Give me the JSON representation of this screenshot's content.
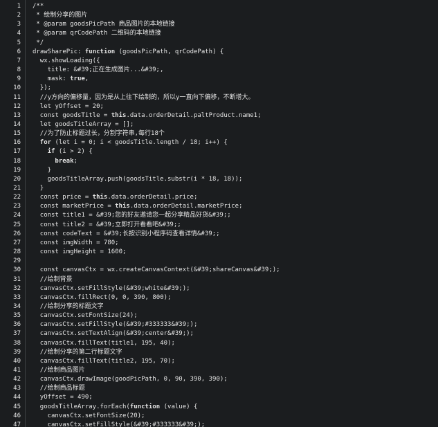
{
  "editor": {
    "lines": [
      {
        "n": "1",
        "indent": 0,
        "tokens": [
          {
            "t": "/**",
            "c": "cm"
          }
        ]
      },
      {
        "n": "2",
        "indent": 1,
        "tokens": [
          {
            "t": "* 绘制分享的图片",
            "c": "cm"
          }
        ]
      },
      {
        "n": "3",
        "indent": 1,
        "tokens": [
          {
            "t": "* @param goodsPicPath 商品图片的本地链接",
            "c": "cm"
          }
        ]
      },
      {
        "n": "4",
        "indent": 1,
        "tokens": [
          {
            "t": "* @param qrCodePath 二维码的本地链接",
            "c": "cm"
          }
        ]
      },
      {
        "n": "5",
        "indent": 1,
        "tokens": [
          {
            "t": "*/",
            "c": "cm"
          }
        ]
      },
      {
        "n": "6",
        "indent": 0,
        "tokens": [
          {
            "t": "drawSharePic: ",
            "c": ""
          },
          {
            "t": "function",
            "c": "kw"
          },
          {
            "t": " (goodsPicPath, qrCodePath) {",
            "c": ""
          }
        ]
      },
      {
        "n": "7",
        "indent": 2,
        "tokens": [
          {
            "t": "wx.showLoading({",
            "c": ""
          }
        ]
      },
      {
        "n": "8",
        "indent": 4,
        "tokens": [
          {
            "t": "title: ",
            "c": ""
          },
          {
            "t": "&#39;正在生成图片...&#39;,",
            "c": "str"
          }
        ]
      },
      {
        "n": "9",
        "indent": 4,
        "tokens": [
          {
            "t": "mask: ",
            "c": ""
          },
          {
            "t": "true",
            "c": "kw"
          },
          {
            "t": ",",
            "c": ""
          }
        ]
      },
      {
        "n": "10",
        "indent": 2,
        "tokens": [
          {
            "t": "});",
            "c": ""
          }
        ]
      },
      {
        "n": "11",
        "indent": 2,
        "tokens": [
          {
            "t": "//y方向的偏移量，因为是从上往下绘制的，所以y一直向下偏移，不断增大。",
            "c": "cm"
          }
        ]
      },
      {
        "n": "12",
        "indent": 2,
        "tokens": [
          {
            "t": "let yOffset = 20;",
            "c": ""
          }
        ]
      },
      {
        "n": "13",
        "indent": 2,
        "tokens": [
          {
            "t": "const goodsTitle = ",
            "c": ""
          },
          {
            "t": "this",
            "c": "kw"
          },
          {
            "t": ".data.orderDetail.paltProduct.name1;",
            "c": ""
          }
        ]
      },
      {
        "n": "14",
        "indent": 2,
        "tokens": [
          {
            "t": "let goodsTitleArray = [];",
            "c": ""
          }
        ]
      },
      {
        "n": "15",
        "indent": 2,
        "tokens": [
          {
            "t": "//为了防止标题过长，分割字符串,每行18个",
            "c": "cm"
          }
        ]
      },
      {
        "n": "16",
        "indent": 2,
        "tokens": [
          {
            "t": "for",
            "c": "kw"
          },
          {
            "t": " (let i = 0; i < goodsTitle.length / 18; i++) {",
            "c": ""
          }
        ]
      },
      {
        "n": "17",
        "indent": 4,
        "tokens": [
          {
            "t": "if",
            "c": "kw"
          },
          {
            "t": " (i > 2) {",
            "c": ""
          }
        ]
      },
      {
        "n": "18",
        "indent": 6,
        "tokens": [
          {
            "t": "break",
            "c": "kw"
          },
          {
            "t": ";",
            "c": ""
          }
        ]
      },
      {
        "n": "19",
        "indent": 4,
        "tokens": [
          {
            "t": "}",
            "c": ""
          }
        ]
      },
      {
        "n": "20",
        "indent": 4,
        "tokens": [
          {
            "t": "goodsTitleArray.push(goodsTitle.substr(i * 18, 18));",
            "c": ""
          }
        ]
      },
      {
        "n": "21",
        "indent": 2,
        "tokens": [
          {
            "t": "}",
            "c": ""
          }
        ]
      },
      {
        "n": "22",
        "indent": 2,
        "tokens": [
          {
            "t": "const price = ",
            "c": ""
          },
          {
            "t": "this",
            "c": "kw"
          },
          {
            "t": ".data.orderDetail.price;",
            "c": ""
          }
        ]
      },
      {
        "n": "23",
        "indent": 2,
        "tokens": [
          {
            "t": "const marketPrice = ",
            "c": ""
          },
          {
            "t": "this",
            "c": "kw"
          },
          {
            "t": ".data.orderDetail.marketPrice;",
            "c": ""
          }
        ]
      },
      {
        "n": "24",
        "indent": 2,
        "tokens": [
          {
            "t": "const title1 = ",
            "c": ""
          },
          {
            "t": "&#39;您的好友邀请您一起分享精品好货&#39;;",
            "c": "str"
          }
        ]
      },
      {
        "n": "25",
        "indent": 2,
        "tokens": [
          {
            "t": "const title2 = ",
            "c": ""
          },
          {
            "t": "&#39;立即打开看看吧&#39;;",
            "c": "str"
          }
        ]
      },
      {
        "n": "26",
        "indent": 2,
        "tokens": [
          {
            "t": "const codeText = ",
            "c": ""
          },
          {
            "t": "&#39;长按识别小程序码查看详情&#39;;",
            "c": "str"
          }
        ]
      },
      {
        "n": "27",
        "indent": 2,
        "tokens": [
          {
            "t": "const imgWidth = 780;",
            "c": ""
          }
        ]
      },
      {
        "n": "28",
        "indent": 2,
        "tokens": [
          {
            "t": "const imgHeight = 1600;",
            "c": ""
          }
        ]
      },
      {
        "n": "29",
        "indent": 0,
        "tokens": []
      },
      {
        "n": "30",
        "indent": 2,
        "tokens": [
          {
            "t": "const canvasCtx = wx.createCanvasContext(&#39;",
            "c": ""
          },
          {
            "t": "shareCanvas&#39;);",
            "c": "str"
          }
        ]
      },
      {
        "n": "31",
        "indent": 2,
        "tokens": [
          {
            "t": "//绘制背景",
            "c": "cm"
          }
        ]
      },
      {
        "n": "32",
        "indent": 2,
        "tokens": [
          {
            "t": "canvasCtx.setFillStyle(&#39;",
            "c": ""
          },
          {
            "t": "white&#39;);",
            "c": "str"
          }
        ]
      },
      {
        "n": "33",
        "indent": 2,
        "tokens": [
          {
            "t": "canvasCtx.fillRect(0, 0, 390, 800);",
            "c": ""
          }
        ]
      },
      {
        "n": "34",
        "indent": 2,
        "tokens": [
          {
            "t": "//绘制分享的标题文字",
            "c": "cm"
          }
        ]
      },
      {
        "n": "35",
        "indent": 2,
        "tokens": [
          {
            "t": "canvasCtx.setFontSize(24);",
            "c": ""
          }
        ]
      },
      {
        "n": "36",
        "indent": 2,
        "tokens": [
          {
            "t": "canvasCtx.setFillStyle(&#39;",
            "c": ""
          },
          {
            "t": "#333333&#39;);",
            "c": "str"
          }
        ]
      },
      {
        "n": "37",
        "indent": 2,
        "tokens": [
          {
            "t": "canvasCtx.setTextAlign(&#39;",
            "c": ""
          },
          {
            "t": "center&#39;);",
            "c": "str"
          }
        ]
      },
      {
        "n": "38",
        "indent": 2,
        "tokens": [
          {
            "t": "canvasCtx.fillText(title1, 195, 40);",
            "c": ""
          }
        ]
      },
      {
        "n": "39",
        "indent": 2,
        "tokens": [
          {
            "t": "//绘制分享的第二行标题文字",
            "c": "cm"
          }
        ]
      },
      {
        "n": "40",
        "indent": 2,
        "tokens": [
          {
            "t": "canvasCtx.fillText(title2, 195, 70);",
            "c": ""
          }
        ]
      },
      {
        "n": "41",
        "indent": 2,
        "tokens": [
          {
            "t": "//绘制商品图片",
            "c": "cm"
          }
        ]
      },
      {
        "n": "42",
        "indent": 2,
        "tokens": [
          {
            "t": "canvasCtx.drawImage(goodPicPath, 0, 90, 390, 390);",
            "c": ""
          }
        ]
      },
      {
        "n": "43",
        "indent": 2,
        "tokens": [
          {
            "t": "//绘制商品标题",
            "c": "cm"
          }
        ]
      },
      {
        "n": "44",
        "indent": 2,
        "tokens": [
          {
            "t": "yOffset = 490;",
            "c": ""
          }
        ]
      },
      {
        "n": "45",
        "indent": 2,
        "tokens": [
          {
            "t": "goodsTitleArray.forEach(",
            "c": ""
          },
          {
            "t": "function",
            "c": "kw"
          },
          {
            "t": " (value) {",
            "c": ""
          }
        ]
      },
      {
        "n": "46",
        "indent": 4,
        "tokens": [
          {
            "t": "canvasCtx.setFontSize(20);",
            "c": ""
          }
        ]
      },
      {
        "n": "47",
        "indent": 4,
        "tokens": [
          {
            "t": "canvasCtx.setFillStyle(&#39;",
            "c": ""
          },
          {
            "t": "#333333&#39;);",
            "c": "str"
          }
        ]
      }
    ]
  },
  "colors": {
    "background": "#1b1d1f",
    "keyword": "#4aa3ff",
    "comment": "#7cf000",
    "string": "#f3f400",
    "text": "#e4e4e4",
    "line_number": "#e8e8e8"
  }
}
